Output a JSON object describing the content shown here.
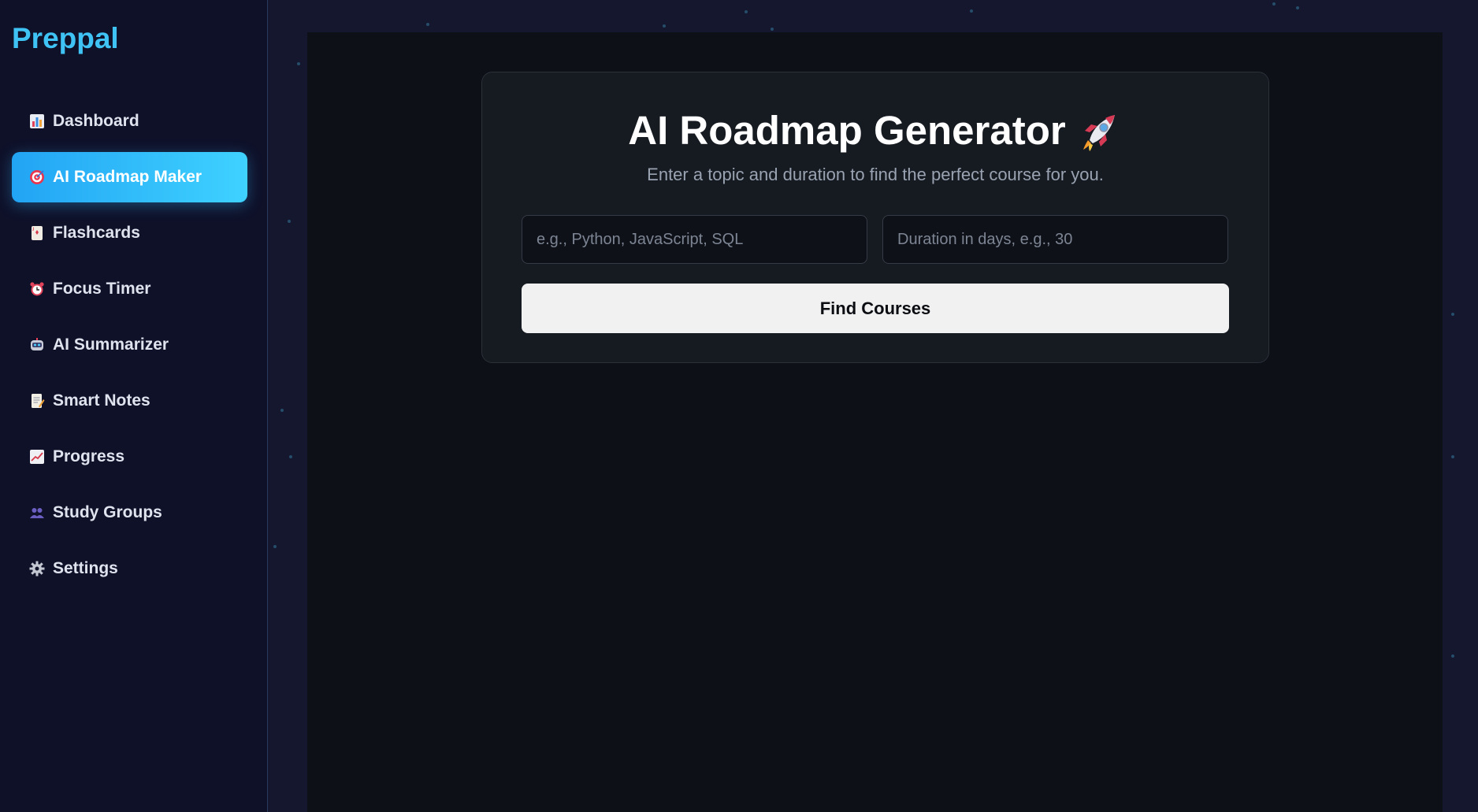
{
  "brand": {
    "name": "Preppal",
    "accent": "#3fc3f4"
  },
  "sidebar": {
    "items": [
      {
        "label": "Dashboard",
        "icon": "bar-chart-icon",
        "active": false
      },
      {
        "label": "AI Roadmap Maker",
        "icon": "target-icon",
        "active": true
      },
      {
        "label": "Flashcards",
        "icon": "card-icon",
        "active": false
      },
      {
        "label": "Focus Timer",
        "icon": "alarm-clock-icon",
        "active": false
      },
      {
        "label": "AI Summarizer",
        "icon": "robot-icon",
        "active": false
      },
      {
        "label": "Smart Notes",
        "icon": "memo-icon",
        "active": false
      },
      {
        "label": "Progress",
        "icon": "trending-up-icon",
        "active": false
      },
      {
        "label": "Study Groups",
        "icon": "people-icon",
        "active": false
      },
      {
        "label": "Settings",
        "icon": "gear-icon",
        "active": false
      }
    ]
  },
  "generator": {
    "title": "AI Roadmap Generator",
    "title_icon": "rocket-icon",
    "subtitle": "Enter a topic and duration to find the perfect course for you.",
    "topic_input": {
      "value": "",
      "placeholder": "e.g., Python, JavaScript, SQL"
    },
    "duration_input": {
      "value": "",
      "placeholder": "Duration in days, e.g., 30"
    },
    "submit_label": "Find Courses"
  },
  "colors": {
    "active_gradient_start": "#22a4f4",
    "active_gradient_end": "#3fd2ff",
    "button_bg": "#f1f1f1"
  }
}
